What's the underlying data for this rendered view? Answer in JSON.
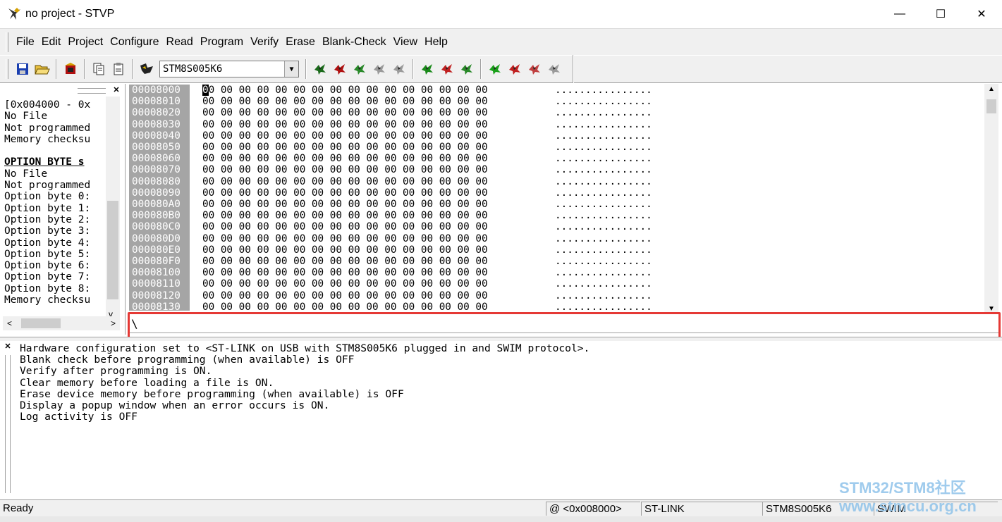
{
  "window": {
    "title": "no project - STVP",
    "minimize": "—",
    "maximize": "☐",
    "close": "✕"
  },
  "menu": [
    "File",
    "Edit",
    "Project",
    "Configure",
    "Read",
    "Program",
    "Verify",
    "Erase",
    "Blank-Check",
    "View",
    "Help"
  ],
  "toolbar": {
    "device": "STM8S005K6",
    "icons": [
      "save-icon",
      "open-icon",
      "project-icon",
      "copy-icon",
      "paste-icon",
      "chip-icon"
    ],
    "action_colors": [
      "#1a6a1a",
      "#b01010",
      "#2a8a2a",
      "#9a9a9a",
      "#9a9a9a",
      "#1a8a1a",
      "#c02020",
      "#2a8a2a",
      "#1aa01a",
      "#c02020",
      "#c04040",
      "#9a9a9a"
    ]
  },
  "left_panel": {
    "lines": [
      "[0x004000 - 0x",
      "No File",
      "Not programmed",
      "Memory checksu",
      "",
      "OPTION BYTE s",
      "No File",
      "Not programmed",
      "Option byte 0:",
      "Option byte 1:",
      "Option byte 2:",
      "Option byte 3:",
      "Option byte 4:",
      "Option byte 5:",
      "Option byte 6:",
      "Option byte 7:",
      "Option byte 8:",
      "Memory checksu"
    ],
    "h_scroll_left": "<",
    "h_scroll_right": ">",
    "v_scroll_down": "v"
  },
  "hex": {
    "addresses": [
      "00008000",
      "00008010",
      "00008020",
      "00008030",
      "00008040",
      "00008050",
      "00008060",
      "00008070",
      "00008080",
      "00008090",
      "000080A0",
      "000080B0",
      "000080C0",
      "000080D0",
      "000080E0",
      "000080F0",
      "00008100",
      "00008110",
      "00008120",
      "00008130"
    ],
    "cursor_byte": "0",
    "bytes_first": "0 00 00 00 00 00 00 00 00 00 00 00 00 00 00 00",
    "bytes": "00 00 00 00 00 00 00 00 00 00 00 00 00 00 00 00",
    "ascii": "................"
  },
  "tab_marker": "\\",
  "log": [
    "Hardware configuration set to <ST-LINK on USB with STM8S005K6 plugged in and SWIM protocol>.",
    "Blank check before programming (when available) is OFF",
    "Verify after programming is ON.",
    "Clear memory before loading a file is ON.",
    "Erase device memory before programming (when available) is OFF",
    "Display a popup window when an error occurs is ON.",
    "Log activity is OFF"
  ],
  "status": {
    "ready": "Ready",
    "address": "@ <0x008000>",
    "tool": "ST-LINK",
    "device": "STM8S005K6",
    "protocol": "SWIM"
  },
  "watermark": {
    "line1": "STM32/STM8社区",
    "line2": "www.stmcu.org.cn"
  }
}
